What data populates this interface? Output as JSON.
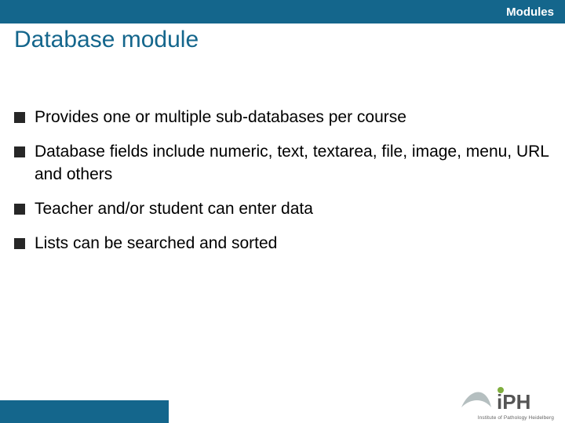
{
  "header": {
    "section": "Modules"
  },
  "title": "Database module",
  "bullets": [
    "Provides one or multiple sub-databases per course",
    "Database fields include numeric, text, textarea, file, image, menu, URL and others",
    "Teacher and/or student can enter data",
    "Lists can be searched and sorted"
  ],
  "logo": {
    "text_main": "iPH",
    "caption": "Institute of Pathology Heidelberg"
  },
  "colors": {
    "brand_blue": "#14668c",
    "logo_grey": "#b5bfc0",
    "logo_green": "#7fae3e"
  }
}
